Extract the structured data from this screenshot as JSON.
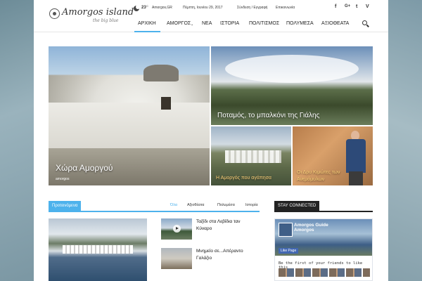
{
  "header": {
    "logo_text": "Amorgos island",
    "logo_sub": "the big blue",
    "temperature": "23",
    "temperature_unit": "C",
    "location": "Amorgos,GR",
    "date": "Πέμπτη, Ιουνίου 29, 2017",
    "login": "Σύνδεση / Εγγραφή",
    "contact": "Επικοινωνία",
    "social": [
      "f",
      "G+",
      "t",
      "V"
    ]
  },
  "menu": {
    "items": [
      {
        "label": "ΑΡΧΙΚΗ"
      },
      {
        "label": "ΑΜΟΡΓΟΣ"
      },
      {
        "label": "ΝΕΑ"
      },
      {
        "label": "ΙΣΤΟΡΙΑ"
      },
      {
        "label": "ΠΟΛΙΤΙΣΜΟΣ"
      },
      {
        "label": "ΠΟΛΥΜΕΣΑ"
      },
      {
        "label": "ΑΞΙΟΘΕΑΤΑ"
      }
    ],
    "active": "ΑΡΧΙΚΗ"
  },
  "hero": {
    "big": {
      "title": "Χώρα Αμοργού",
      "tag": "amorgos"
    },
    "top_right": {
      "title": "Ποταμός, το μπαλκόνι της Γιάλης"
    },
    "bottom_left": {
      "title": "Η Αμοργός που αγάπησα"
    },
    "bottom_right": {
      "title_line1": "Οι Δρυ Κιμώτες των",
      "title_line2": "Ανεμόμυλων"
    }
  },
  "featured": {
    "label": "Προτεινόμενα",
    "filters": [
      "Όλα",
      "Αξιοθέατα",
      "Πολυμέσα",
      "Ιστορία"
    ],
    "items": [
      {
        "title_line1": "Ταξίδι στα Λεβίδια ταν",
        "title_line2": "Κύναρο"
      },
      {
        "title_line1": "Μνημείο σε...Απέραντο",
        "title_line2": "Γαλάζιο"
      }
    ]
  },
  "stay_connected": {
    "label": "STAY CONNECTED",
    "fb_name_line1": "Amorgos Guide",
    "fb_name_line2": "Amorgos",
    "fb_likes": "",
    "fb_like_button": "Like Page",
    "fb_text": "Be the first of your friends to like this"
  }
}
